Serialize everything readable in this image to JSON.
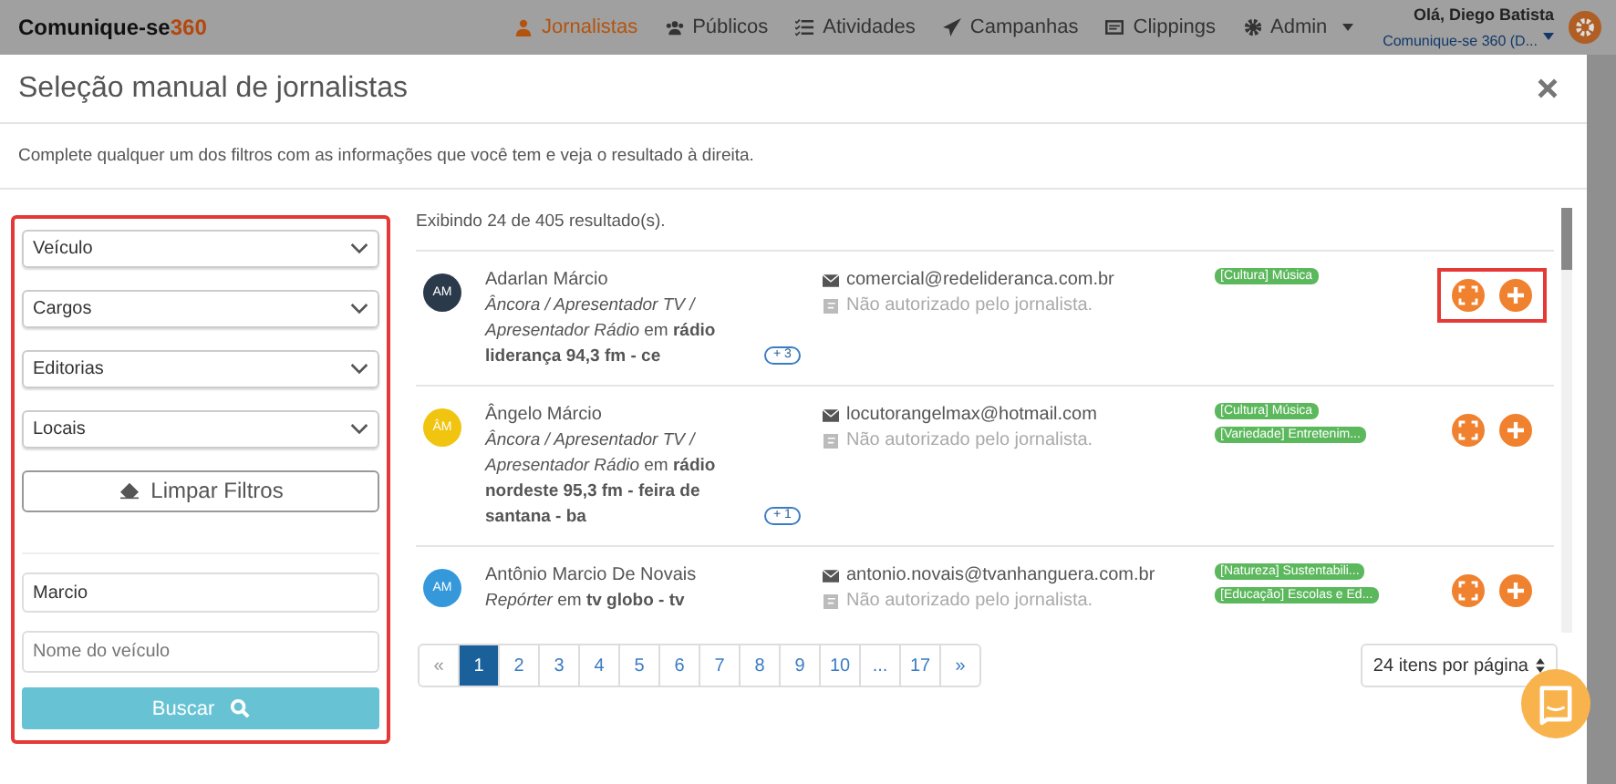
{
  "navbar": {
    "logo": "Comunique-se",
    "logo_accent": "360",
    "items": [
      {
        "label": "Jornalistas",
        "selected": true,
        "dropdown": false
      },
      {
        "label": "Públicos",
        "selected": false,
        "dropdown": false
      },
      {
        "label": "Atividades",
        "selected": false,
        "dropdown": false
      },
      {
        "label": "Campanhas",
        "selected": false,
        "dropdown": false
      },
      {
        "label": "Clippings",
        "selected": false,
        "dropdown": false
      },
      {
        "label": "Admin",
        "selected": false,
        "dropdown": true
      }
    ],
    "user": {
      "greeting": "Olá, Diego Batista",
      "account": "Comunique-se 360 (D..."
    }
  },
  "modal": {
    "title": "Seleção manual de jornalistas",
    "description": "Complete qualquer um dos filtros com as informações que você tem e veja o resultado à direita."
  },
  "filters": {
    "selects": [
      "Veículo",
      "Cargos",
      "Editorias",
      "Locais"
    ],
    "clear_button": "Limpar Filtros",
    "inputs": [
      {
        "value": "Marcio"
      },
      {
        "placeholder": "Nome do veículo"
      }
    ],
    "search_button": "Buscar"
  },
  "results": {
    "summary": "Exibindo 24 de 405 resultado(s).",
    "items": [
      {
        "initials": "AM",
        "color": "#2b3a4a",
        "name": "Adarlan Márcio",
        "role": "*Âncora / Apresentador TV / Apresentador Rádio* em **rádio liderança 94,3 fm - ce**",
        "more": "+ 3",
        "email": "comercial@redelideranca.com.br",
        "phone": "Não autorizado pelo jornalista.",
        "tags": [
          "[Cultura] Música"
        ],
        "highlighted": true
      },
      {
        "initials": "ÂM",
        "color": "#f1c40f",
        "name": "Ângelo Márcio",
        "role": "*Âncora / Apresentador TV / Apresentador Rádio* em **rádio nordeste 95,3 fm - feira de santana - ba**",
        "more": "+ 1",
        "email": "locutorangelmax@hotmail.com",
        "phone": "Não autorizado pelo jornalista.",
        "tags": [
          "[Cultura] Música",
          "[Variedade] Entretenim..."
        ],
        "highlighted": false
      },
      {
        "initials": "AM",
        "color": "#3498db",
        "name": "Antônio Marcio De Novais",
        "role": "*Repórter* em **tv globo - tv**",
        "email": "antonio.novais@tvanhanguera.com.br",
        "phone": "Não autorizado pelo jornalista.",
        "tags": [
          "[Natureza] Sustentabili...",
          "[Educação] Escolas e Ed..."
        ],
        "highlighted": false
      }
    ]
  },
  "pagination": {
    "prev": "«",
    "pages": [
      {
        "label": "1",
        "selected": true
      },
      {
        "label": "2",
        "selected": false
      },
      {
        "label": "3",
        "selected": false
      },
      {
        "label": "4",
        "selected": false
      },
      {
        "label": "5",
        "selected": false
      },
      {
        "label": "6",
        "selected": false
      },
      {
        "label": "7",
        "selected": false
      },
      {
        "label": "8",
        "selected": false
      },
      {
        "label": "9",
        "selected": false
      },
      {
        "label": "10",
        "selected": false
      },
      {
        "label": "...",
        "selected": false
      },
      {
        "label": "17",
        "selected": false
      }
    ],
    "next": "»"
  },
  "per_page": "24 itens por página"
}
